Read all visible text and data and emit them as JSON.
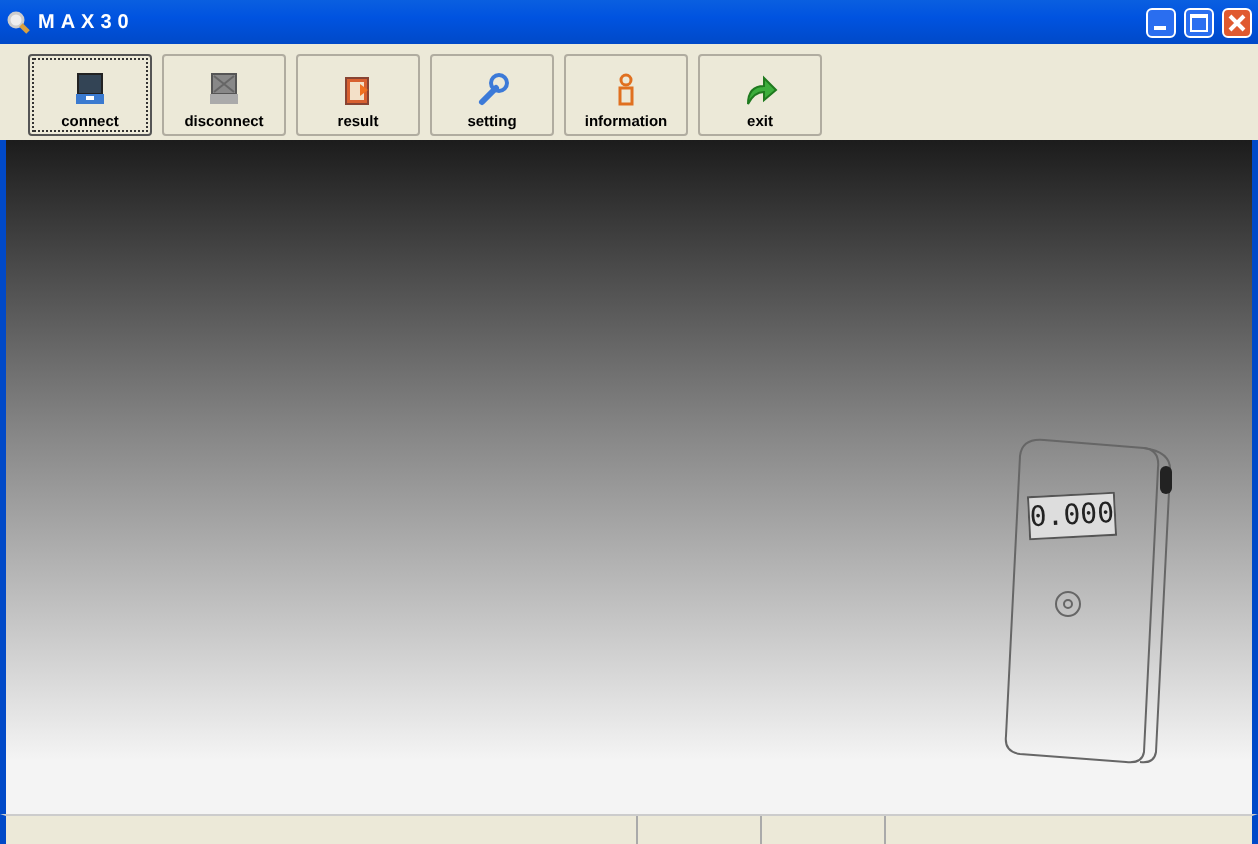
{
  "window": {
    "title": "MAX30"
  },
  "toolbar": [
    {
      "label": "connect",
      "kind": "connect",
      "focused": true
    },
    {
      "label": "disconnect",
      "kind": "disconnect",
      "focused": false
    },
    {
      "label": "result",
      "kind": "result",
      "focused": false
    },
    {
      "label": "setting",
      "kind": "setting",
      "focused": false
    },
    {
      "label": "information",
      "kind": "information",
      "focused": false
    },
    {
      "label": "exit",
      "kind": "exit",
      "focused": false
    }
  ],
  "device": {
    "display": "0.000"
  }
}
